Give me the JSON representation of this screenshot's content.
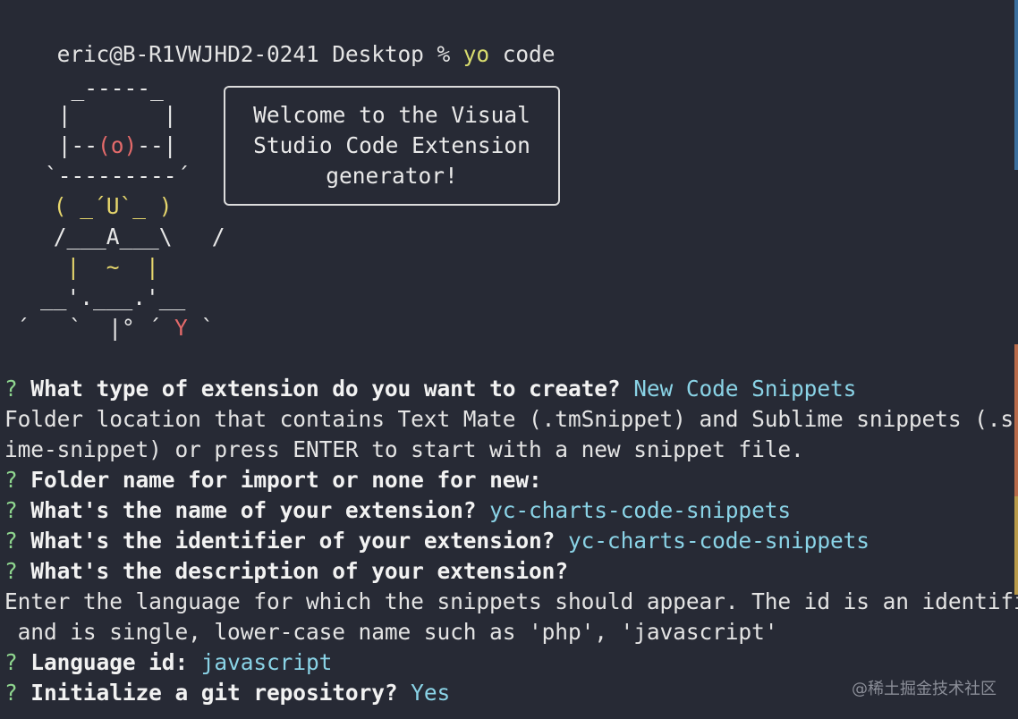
{
  "prompt_line": {
    "prompt": "eric@B-R1VWJHD2-0241 Desktop % ",
    "command": "yo",
    "argument": " code"
  },
  "ascii_art": {
    "row1": "  _-----_",
    "row2": " |       |",
    "row3_left": " |--",
    "row3_eye": "(o)",
    "row3_right": "--|",
    "row4": "`---------´",
    "row5": " ( _´U`_ )",
    "row6": " /___A___\\   /",
    "row7": "  |  ~  |",
    "row8": "__'.___.'__",
    "row9_left": "´   `  |",
    "row9_mid": "° ´ ",
    "row9_y": "Y",
    "row9_end": " `"
  },
  "welcome": {
    "line1": "Welcome to the Visual",
    "line2": "Studio Code Extension",
    "line3": "generator!"
  },
  "qa": [
    {
      "mark": "?",
      "question": " What type of extension do you want to create? ",
      "answer": "New Code Snippets"
    },
    {
      "plain": "Folder location that contains Text Mate (.tmSnippet) and Sublime snippets (.subl"
    },
    {
      "plain": "ime-snippet) or press ENTER to start with a new snippet file."
    },
    {
      "mark": "?",
      "question": " Folder name for import or none for new:",
      "answer": ""
    },
    {
      "mark": "?",
      "question": " What's the name of your extension? ",
      "answer": "yc-charts-code-snippets"
    },
    {
      "mark": "?",
      "question": " What's the identifier of your extension? ",
      "answer": "yc-charts-code-snippets"
    },
    {
      "mark": "?",
      "question": " What's the description of your extension?",
      "answer": ""
    },
    {
      "plain": "Enter the language for which the snippets should appear. The id is an identifier"
    },
    {
      "plain": " and is single, lower-case name such as 'php', 'javascript'"
    },
    {
      "mark": "?",
      "question": " Language id: ",
      "answer": "javascript"
    },
    {
      "mark": "?",
      "question": " Initialize a git repository? ",
      "answer": "Yes"
    }
  ],
  "watermark": "@稀土掘金技术社区",
  "colors": {
    "background": "#272a35",
    "question_mark": "#8fd68f",
    "answer": "#8ad3e6",
    "command": "#d8dc6e",
    "art_red": "#e36a6a",
    "art_yellow": "#e6d66c"
  }
}
